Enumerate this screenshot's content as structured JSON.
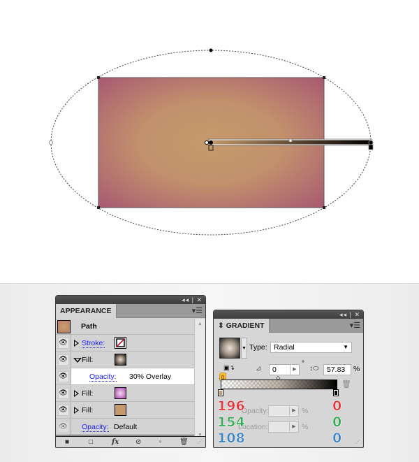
{
  "colors": {
    "rect_inner": "#c49a6c",
    "rect_outer": "#b06878",
    "red": "#e8323a",
    "green": "#34a853",
    "blue": "#3a82c4",
    "link": "#1a1aff",
    "orange_badge": "#f0c040"
  },
  "appearance": {
    "tab_label": "APPEARANCE",
    "panel_controls": "◂◂ | ✕",
    "header": {
      "label": "Path"
    },
    "rows": [
      {
        "type": "stroke",
        "label": "Stroke:",
        "swatch": "none-stroke"
      },
      {
        "type": "fill",
        "label": "Fill:",
        "swatch": "radial-gradient-black"
      },
      {
        "type": "opacity",
        "label": "Opacity:",
        "value": "30% Overlay"
      },
      {
        "type": "fill",
        "label": "Fill:",
        "swatch": "radial-gradient-pink"
      },
      {
        "type": "fill",
        "label": "Fill:",
        "swatch": "solid-tan"
      },
      {
        "type": "opacity",
        "label": "Opacity:",
        "value": "Default"
      }
    ],
    "footer_icons": [
      "add-stroke-icon",
      "add-fill-icon",
      "fx-icon",
      "clear-appearance-icon",
      "duplicate-item-icon",
      "trash-icon"
    ],
    "fx_label": "fx"
  },
  "gradient": {
    "tab_label": "GRADIENT",
    "panel_controls": "◂◂ | ✕",
    "type_label": "Type:",
    "type_value": "Radial",
    "angle_value": "0",
    "degree_symbol": "°",
    "aspect_value": "57.83",
    "percent": "%",
    "opacity_label": "Opacity:",
    "location_label": "Location:",
    "badge_number": "0",
    "left_stop_rgb": {
      "r": "196",
      "g": "154",
      "b": "108"
    },
    "right_stop_rgb": {
      "r": "0",
      "g": "0",
      "b": "0"
    }
  }
}
